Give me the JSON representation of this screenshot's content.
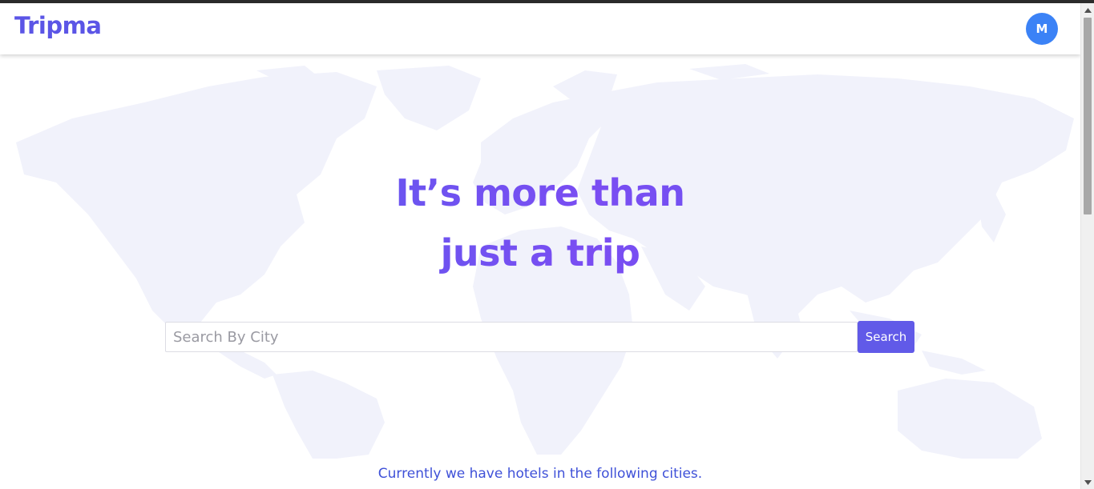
{
  "header": {
    "logo_text": "Tripma",
    "avatar_initial": "M"
  },
  "hero": {
    "headline_line1": "It’s more than",
    "headline_line2": "just a trip",
    "background_image": "world-map-icon"
  },
  "search": {
    "placeholder": "Search By City",
    "value": "",
    "button_label": "Search"
  },
  "cities_section": {
    "note": "Currently we have hotels in the following cities."
  },
  "colors": {
    "brand": "#5b55e6",
    "avatar": "#3b82f6",
    "button": "#615ae8",
    "note_text": "#3f51d8",
    "map_tint": "#f1f2fb"
  }
}
